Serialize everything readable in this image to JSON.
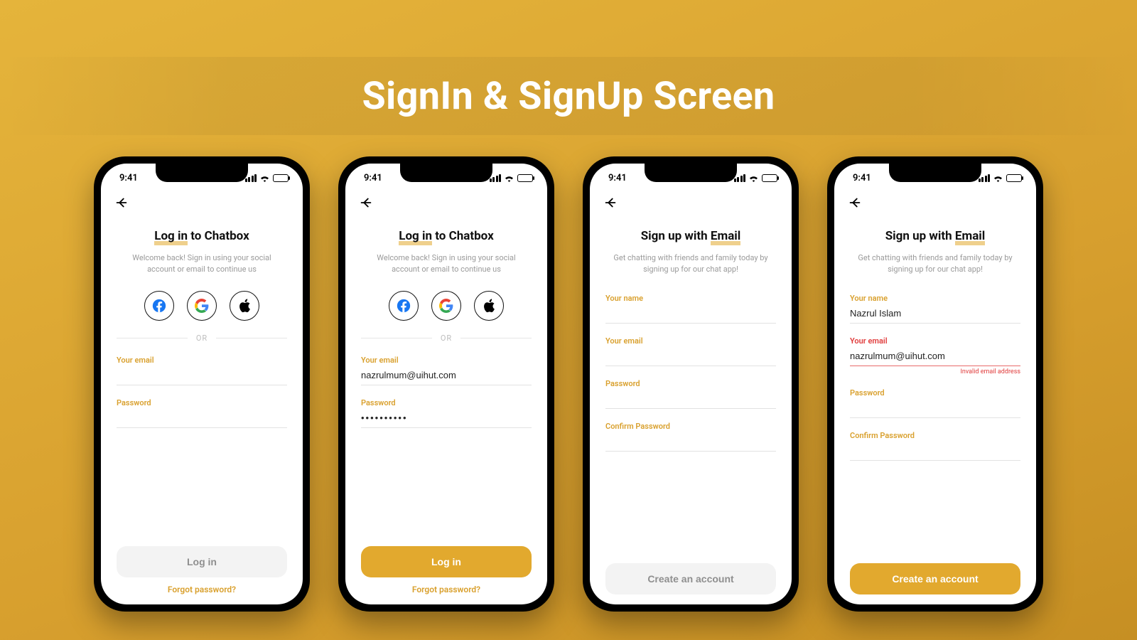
{
  "page_title": "SignIn & SignUp Screen",
  "status": {
    "time": "9:41"
  },
  "colors": {
    "accent": "#e2a92e",
    "error": "#e03b3b"
  },
  "signin": {
    "heading_ul": "Log in",
    "heading_rest": " to Chatbox",
    "subtext": "Welcome back! Sign in using your social account or email to continue us",
    "or": "OR",
    "labels": {
      "email": "Your email",
      "password": "Password"
    },
    "cta": "Log in",
    "forgot": "Forgot password?"
  },
  "signin_filled": {
    "email_value": "nazrulmum@uihut.com",
    "password_value": "••••••••••"
  },
  "signup": {
    "heading_pre": "Sign up with ",
    "heading_ul": "Email",
    "subtext": "Get chatting with friends and family today by signing up for our chat app!",
    "labels": {
      "name": "Your name",
      "email": "Your email",
      "password": "Password",
      "confirm": "Confirm Password"
    },
    "cta": "Create an account"
  },
  "signup_filled": {
    "name_value": "Nazrul Islam",
    "email_value": "nazrulmum@uihut.com",
    "error_text": "Invalid email address"
  }
}
